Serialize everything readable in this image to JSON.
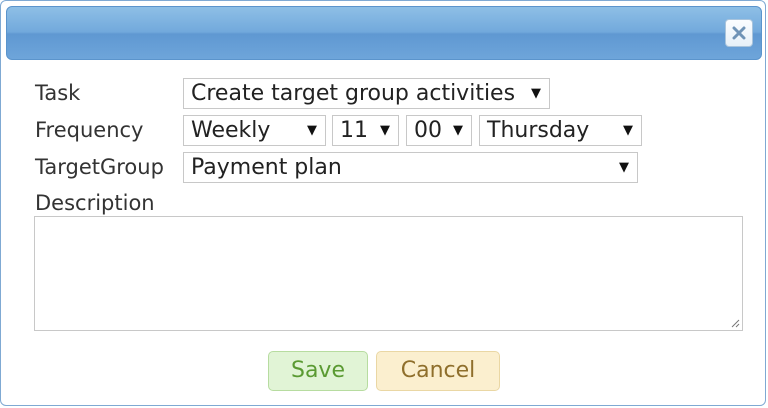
{
  "dialog": {
    "close_icon": "close-icon"
  },
  "form": {
    "task": {
      "label": "Task",
      "value": "Create target group activities"
    },
    "frequency": {
      "label": "Frequency",
      "period": "Weekly",
      "hour": "11",
      "minute": "00",
      "day": "Thursday"
    },
    "target_group": {
      "label": "TargetGroup",
      "value": "Payment plan"
    },
    "description": {
      "label": "Description",
      "value": ""
    }
  },
  "buttons": {
    "save": "Save",
    "cancel": "Cancel"
  },
  "colors": {
    "titlebar": "#6ea5da",
    "save_bg": "#e1f4d6",
    "save_text": "#5a9a32",
    "cancel_bg": "#fbefcf",
    "cancel_text": "#8f6f2c"
  }
}
